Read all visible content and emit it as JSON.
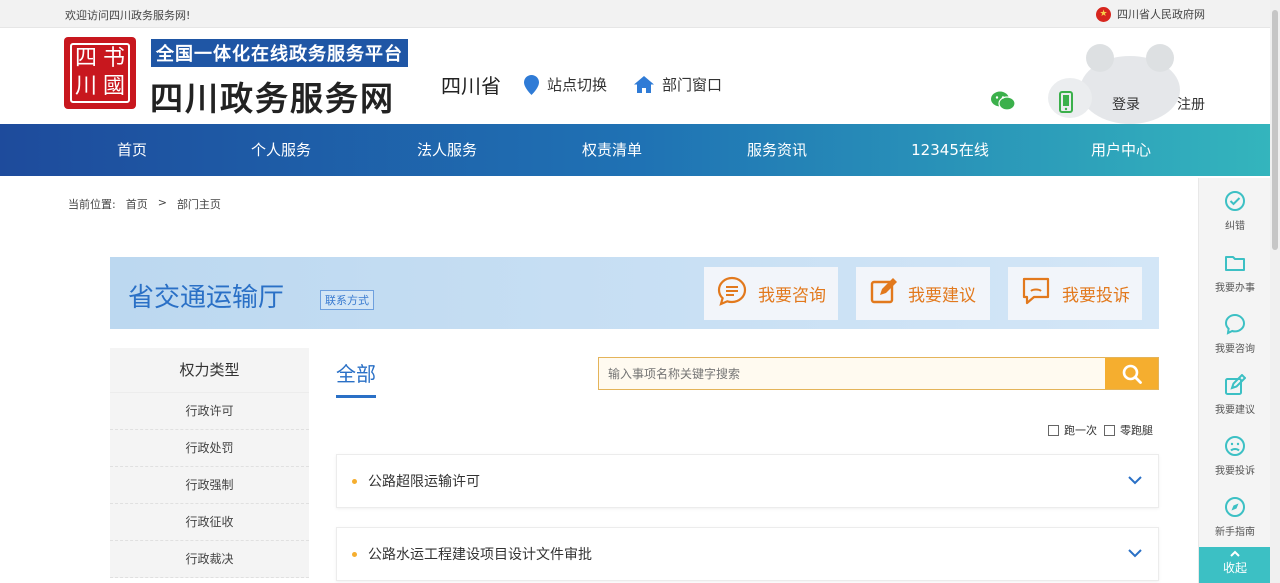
{
  "topbar": {
    "welcome": "欢迎访问四川政务服务网!",
    "gov_link": "四川省人民政府网"
  },
  "header": {
    "slogan": "全国一体化在线政务服务平台",
    "site_name": "四川政务服务网",
    "province": "四川省",
    "site_switch": "站点切换",
    "dept_window": "部门窗口",
    "login": "登录",
    "register": "注册"
  },
  "nav": [
    {
      "label": "首页"
    },
    {
      "label": "个人服务"
    },
    {
      "label": "法人服务"
    },
    {
      "label": "权责清单"
    },
    {
      "label": "服务资讯"
    },
    {
      "label": "12345在线"
    },
    {
      "label": "用户中心"
    }
  ],
  "breadcrumb": {
    "prefix": "当前位置:",
    "home": "首页",
    "sep": ">",
    "current": "部门主页"
  },
  "department": {
    "name": "省交通运输厅",
    "contact": "联系方式",
    "actions": [
      {
        "label": "我要咨询",
        "icon": "chat-icon"
      },
      {
        "label": "我要建议",
        "icon": "edit-icon"
      },
      {
        "label": "我要投诉",
        "icon": "complaint-icon"
      }
    ]
  },
  "side_menu": {
    "title": "权力类型",
    "items": [
      "行政许可",
      "行政处罚",
      "行政强制",
      "行政征收",
      "行政裁决"
    ]
  },
  "main": {
    "tab_all": "全部",
    "search_placeholder": "输入事项名称关键字搜索",
    "filters": [
      "跑一次",
      "零跑腿"
    ],
    "items": [
      "公路超限运输许可",
      "公路水运工程建设项目设计文件审批"
    ]
  },
  "float_bar": {
    "items": [
      "纠错",
      "我要办事",
      "我要咨询",
      "我要建议",
      "我要投诉",
      "新手指南"
    ],
    "collapse": "收起"
  },
  "colors": {
    "brand_blue": "#1f56a5",
    "accent_orange": "#f5ae2f",
    "teal": "#3cc0c4"
  }
}
